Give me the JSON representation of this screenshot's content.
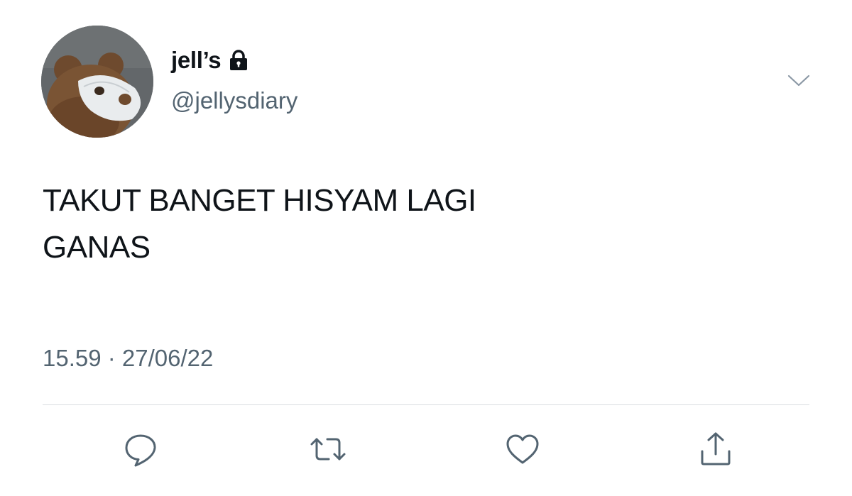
{
  "tweet": {
    "author": {
      "display_name": "jell’s",
      "handle": "@jellysdiary",
      "protected_icon": "lock-icon",
      "avatar": "teddy-bear-with-face-mask-avatar"
    },
    "text_lines": [
      "TAKUT BANGET HISYAM LAGI",
      "GANAS"
    ],
    "timestamp": "15.59 · 27/06/22"
  },
  "menu": {
    "icon": "chevron-down-icon"
  },
  "actions": [
    {
      "name": "reply",
      "icon": "reply-icon"
    },
    {
      "name": "retweet",
      "icon": "retweet-icon"
    },
    {
      "name": "like",
      "icon": "heart-icon"
    },
    {
      "name": "share",
      "icon": "share-icon"
    }
  ],
  "colors": {
    "text": "#0f1419",
    "secondary": "#536471",
    "divider": "#d9dde0",
    "background": "#ffffff"
  }
}
